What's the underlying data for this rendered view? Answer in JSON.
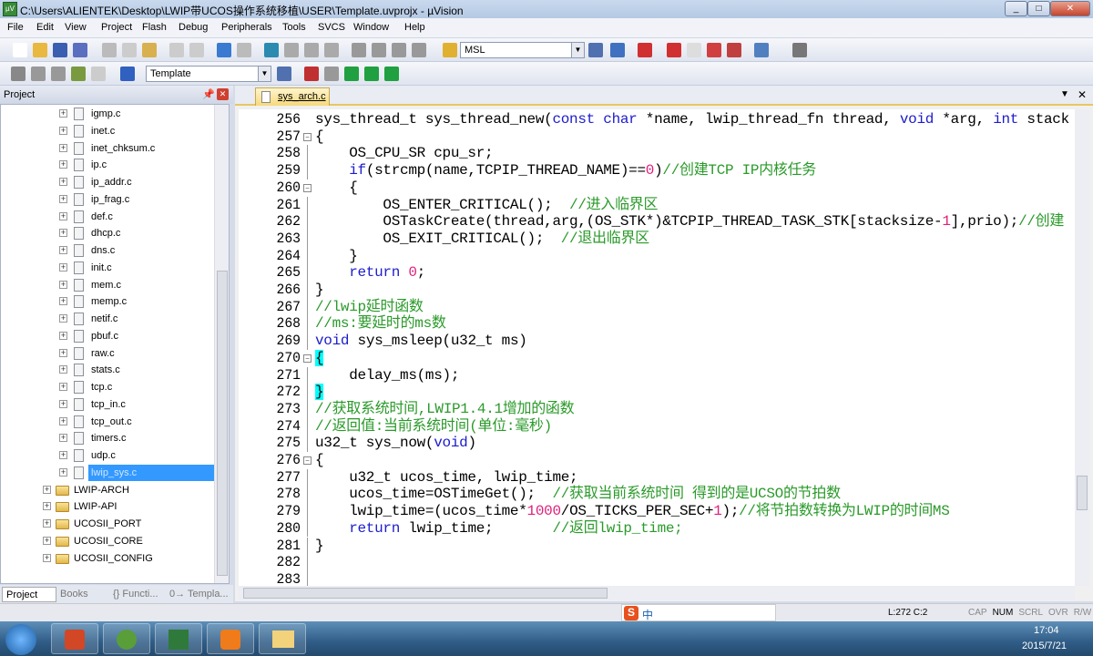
{
  "window": {
    "title": "C:\\Users\\ALIENTEK\\Desktop\\LWIP带UCOS操作系统移植\\USER\\Template.uvprojx - µVision",
    "icon": "uvision-icon"
  },
  "menu": [
    "File",
    "Edit",
    "View",
    "Project",
    "Flash",
    "Debug",
    "Peripherals",
    "Tools",
    "SVCS",
    "Window",
    "Help"
  ],
  "toolbar": {
    "find_combo": "MSL",
    "target_combo": "Template"
  },
  "project_panel": {
    "title": "Project",
    "files": [
      "igmp.c",
      "inet.c",
      "inet_chksum.c",
      "ip.c",
      "ip_addr.c",
      "ip_frag.c",
      "def.c",
      "dhcp.c",
      "dns.c",
      "init.c",
      "mem.c",
      "memp.c",
      "netif.c",
      "pbuf.c",
      "raw.c",
      "stats.c",
      "tcp.c",
      "tcp_in.c",
      "tcp_out.c",
      "timers.c",
      "udp.c",
      "lwip_sys.c"
    ],
    "selected_file": "lwip_sys.c",
    "groups": [
      "LWIP-ARCH",
      "LWIP-API",
      "UCOSII_PORT",
      "UCOSII_CORE",
      "UCOSII_CONFIG"
    ],
    "tabs": [
      "Project",
      "Books",
      "{} Functi...",
      "0→ Templa..."
    ]
  },
  "editor": {
    "tab": "sys_arch.c",
    "lines": [
      {
        "n": "256",
        "f": "",
        "t": [
          [
            "",
            "sys_thread_t sys_thread_new("
          ],
          [
            "kw",
            "const char"
          ],
          [
            "",
            " *name, lwip_thread_fn thread, "
          ],
          [
            "kw",
            "void"
          ],
          [
            "",
            " *arg, "
          ],
          [
            "kw",
            "int"
          ],
          [
            "",
            " stack"
          ]
        ]
      },
      {
        "n": "257",
        "f": "open",
        "t": [
          [
            "",
            "{"
          ]
        ]
      },
      {
        "n": "258",
        "f": "",
        "t": [
          [
            "",
            "    OS_CPU_SR cpu_sr;"
          ]
        ]
      },
      {
        "n": "259",
        "f": "",
        "t": [
          [
            "kw",
            "    if"
          ],
          [
            "",
            "(strcmp(name,TCPIP_THREAD_NAME)=="
          ],
          [
            "num",
            "0"
          ],
          [
            "",
            ")"
          ],
          [
            "cm",
            "//创建TCP IP内核任务"
          ]
        ]
      },
      {
        "n": "260",
        "f": "open",
        "t": [
          [
            "",
            "    {"
          ]
        ]
      },
      {
        "n": "261",
        "f": "",
        "t": [
          [
            "",
            "        OS_ENTER_CRITICAL();  "
          ],
          [
            "cm",
            "//进入临界区"
          ]
        ]
      },
      {
        "n": "262",
        "f": "",
        "t": [
          [
            "",
            "        OSTaskCreate(thread,arg,(OS_STK*)&TCPIP_THREAD_TASK_STK[stacksize-"
          ],
          [
            "num",
            "1"
          ],
          [
            "",
            "],prio);"
          ],
          [
            "cm",
            "//创建"
          ]
        ]
      },
      {
        "n": "263",
        "f": "",
        "t": [
          [
            "",
            "        OS_EXIT_CRITICAL();  "
          ],
          [
            "cm",
            "//退出临界区"
          ]
        ]
      },
      {
        "n": "264",
        "f": "end",
        "t": [
          [
            "",
            "    }"
          ]
        ]
      },
      {
        "n": "265",
        "f": "",
        "t": [
          [
            "kw",
            "    return"
          ],
          [
            "",
            " "
          ],
          [
            "num",
            "0"
          ],
          [
            "",
            ";"
          ]
        ]
      },
      {
        "n": "266",
        "f": "end",
        "t": [
          [
            "",
            "}"
          ]
        ]
      },
      {
        "n": "267",
        "f": "",
        "t": [
          [
            "cm",
            "//lwip延时函数"
          ]
        ]
      },
      {
        "n": "268",
        "f": "",
        "t": [
          [
            "cm",
            "//ms:要延时的ms数"
          ]
        ]
      },
      {
        "n": "269",
        "f": "",
        "t": [
          [
            "kw",
            "void"
          ],
          [
            "",
            " sys_msleep(u32_t ms)"
          ]
        ]
      },
      {
        "n": "270",
        "f": "open",
        "t": [
          [
            "br",
            "{"
          ]
        ]
      },
      {
        "n": "271",
        "f": "",
        "t": [
          [
            "",
            "    delay_ms(ms);"
          ]
        ]
      },
      {
        "n": "272",
        "f": "end",
        "t": [
          [
            "br",
            "}"
          ]
        ]
      },
      {
        "n": "273",
        "f": "",
        "t": [
          [
            "cm",
            "//获取系统时间,LWIP1.4.1增加的函数"
          ]
        ]
      },
      {
        "n": "274",
        "f": "",
        "t": [
          [
            "cm",
            "//返回值:当前系统时间(单位:毫秒)"
          ]
        ]
      },
      {
        "n": "275",
        "f": "",
        "t": [
          [
            "",
            "u32_t sys_now("
          ],
          [
            "kw",
            "void"
          ],
          [
            "",
            ")"
          ]
        ]
      },
      {
        "n": "276",
        "f": "open",
        "t": [
          [
            "",
            "{"
          ]
        ]
      },
      {
        "n": "277",
        "f": "",
        "t": [
          [
            "",
            "    u32_t ucos_time, lwip_time;"
          ]
        ]
      },
      {
        "n": "278",
        "f": "",
        "t": [
          [
            "",
            "    ucos_time=OSTimeGet();  "
          ],
          [
            "cm",
            "//获取当前系统时间 得到的是UCSO的节拍数"
          ]
        ]
      },
      {
        "n": "279",
        "f": "",
        "t": [
          [
            "",
            "    lwip_time=(ucos_time*"
          ],
          [
            "num",
            "1000"
          ],
          [
            "",
            "/OS_TICKS_PER_SEC+"
          ],
          [
            "num",
            "1"
          ],
          [
            "",
            ");"
          ],
          [
            "cm",
            "//将节拍数转换为LWIP的时间MS"
          ]
        ]
      },
      {
        "n": "280",
        "f": "",
        "t": [
          [
            "kw",
            "    return"
          ],
          [
            "",
            " lwip_time;       "
          ],
          [
            "cm",
            "//返回lwip_time;"
          ]
        ]
      },
      {
        "n": "281",
        "f": "end",
        "t": [
          [
            "",
            "}"
          ]
        ]
      },
      {
        "n": "282",
        "f": "",
        "t": []
      },
      {
        "n": "283",
        "f": "",
        "t": []
      }
    ]
  },
  "status": {
    "position": "L:272 C:2",
    "indicators": [
      "CAP",
      "NUM",
      "SCRL",
      "OVR",
      "R/W"
    ],
    "ime": "中"
  },
  "taskbar": {
    "time": "17:04",
    "date": "2015/7/21"
  },
  "colors": {
    "keyword": "#1c1ccc",
    "comment": "#2a9a2a",
    "number": "#e0207a",
    "brace_match": "#00ffff",
    "selection": "#3399ff"
  }
}
